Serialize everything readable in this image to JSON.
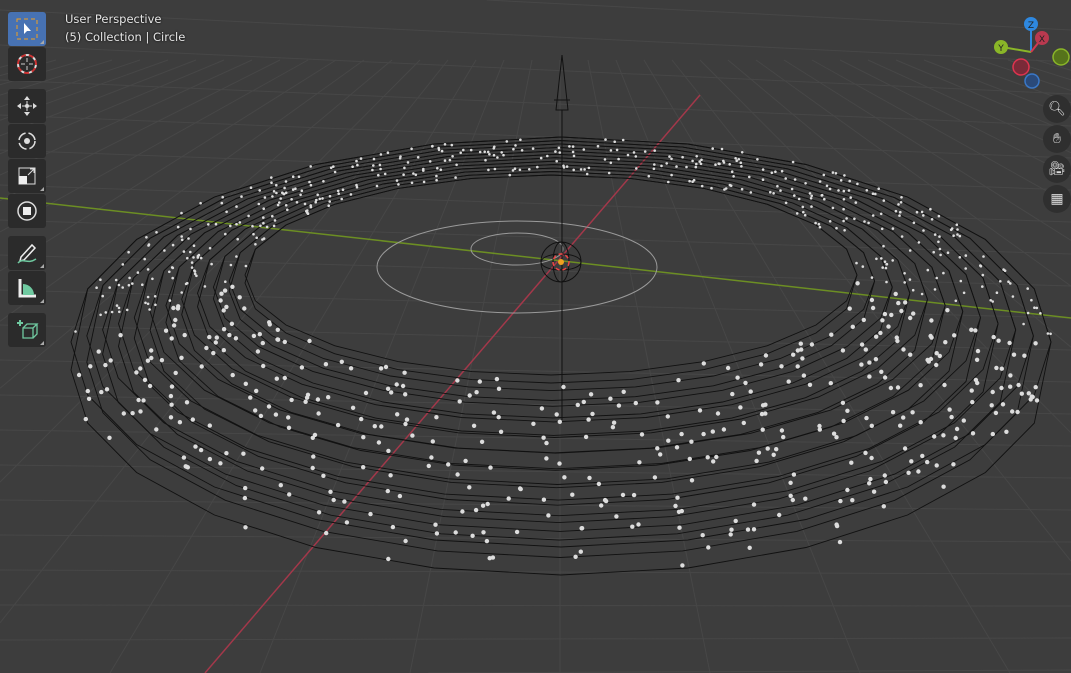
{
  "viewport": {
    "view_name": "User Perspective",
    "collection_info": "(5) Collection | Circle"
  },
  "toolbar": {
    "tools": [
      {
        "name": "select-box",
        "active": true
      },
      {
        "name": "cursor"
      },
      {
        "name": "move"
      },
      {
        "name": "rotate"
      },
      {
        "name": "scale"
      },
      {
        "name": "transform"
      },
      {
        "name": "annotate"
      },
      {
        "name": "measure"
      },
      {
        "name": "add-cube"
      }
    ]
  },
  "gizmo": {
    "x_label": "X",
    "y_label": "Y",
    "z_label": "Z",
    "colors": {
      "x": "#d2394f",
      "y": "#8ab628",
      "z": "#2e88e0"
    }
  },
  "nav_buttons": [
    "zoom-icon",
    "pan-hand-icon",
    "camera-icon",
    "ortho-grid-icon"
  ],
  "colors": {
    "background": "#3d3d3d",
    "grid": "#4a4a4a",
    "x_axis": "#a3384a",
    "y_axis": "#6c8e23",
    "accent": "#4772b3"
  }
}
